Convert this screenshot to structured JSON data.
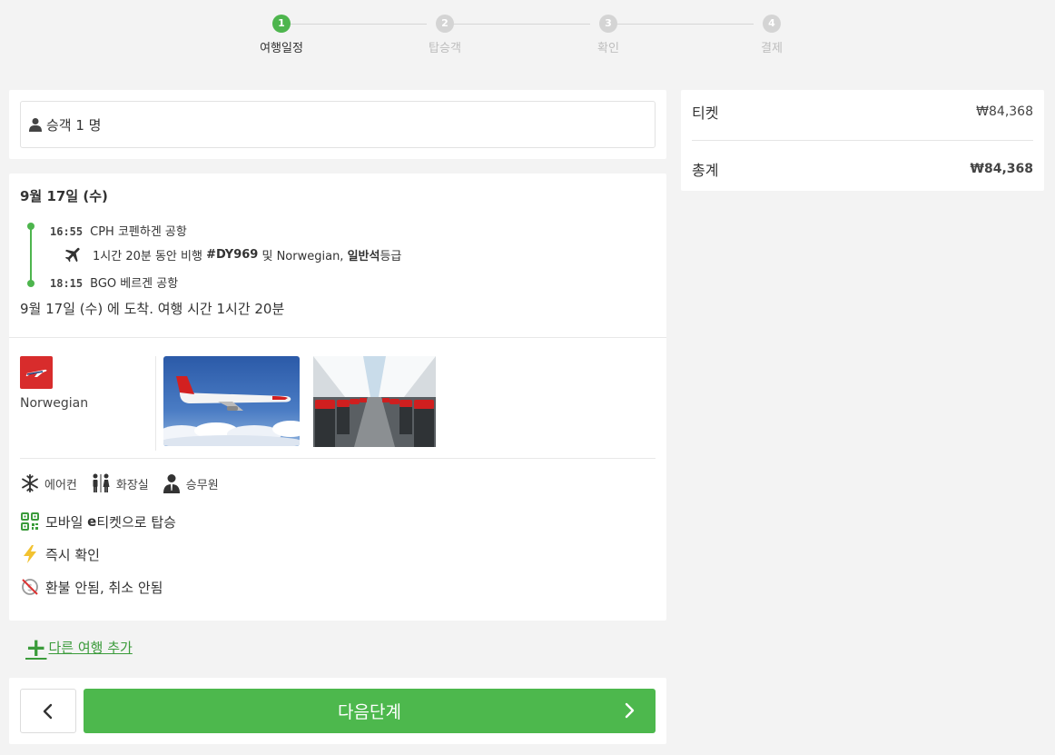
{
  "stepper": {
    "steps": [
      {
        "num": "1",
        "label": "여행일정"
      },
      {
        "num": "2",
        "label": "탑승객"
      },
      {
        "num": "3",
        "label": "확인"
      },
      {
        "num": "4",
        "label": "결제"
      }
    ],
    "active_index": 0,
    "accent": "#4db54d"
  },
  "passengers": {
    "label": "승객 1 명",
    "icon": "person-icon"
  },
  "itinerary": {
    "date_title": "9월 17일 (수)",
    "departure": {
      "time": "16:55",
      "place": "CPH 코펜하겐 공항"
    },
    "flight": {
      "text_1": "1시간 20분 동안 비행 ",
      "flight_no": "#DY969",
      "text_2": " 및 Norwegian, ",
      "cabin": "일반석",
      "text_3": "등급",
      "icon": "airplane-icon"
    },
    "arrival": {
      "time": "18:15",
      "place": "BGO 베르겐 공항"
    },
    "arrival_note": "9월 17일 (수) 에 도착. 여행 시간 1시간 20분",
    "airline": {
      "name": "Norwegian",
      "logo_color": "#d82c2c"
    },
    "amenities": [
      {
        "label": "에어컨",
        "icon": "snowflake-icon"
      },
      {
        "label": "화장실",
        "icon": "restroom-icon"
      },
      {
        "label": "승무원",
        "icon": "flight-attendant-icon"
      }
    ],
    "features": [
      {
        "pre": "모바일 ",
        "bold": "e",
        "post": "티켓으로 탑승",
        "icon": "qr-code-icon"
      },
      {
        "pre": "즉시 확인",
        "bold": "",
        "post": "",
        "icon": "lightning-icon"
      },
      {
        "pre": "환불 안됨, 취소 안됨",
        "bold": "",
        "post": "",
        "icon": "no-refund-icon"
      }
    ]
  },
  "add_trip": {
    "label": "다른 여행 추가"
  },
  "nav": {
    "next_label": "다음단계"
  },
  "summary": {
    "ticket_label": "티켓",
    "ticket_value": "₩84,368",
    "total_label": "총계",
    "total_value": "₩84,368"
  }
}
